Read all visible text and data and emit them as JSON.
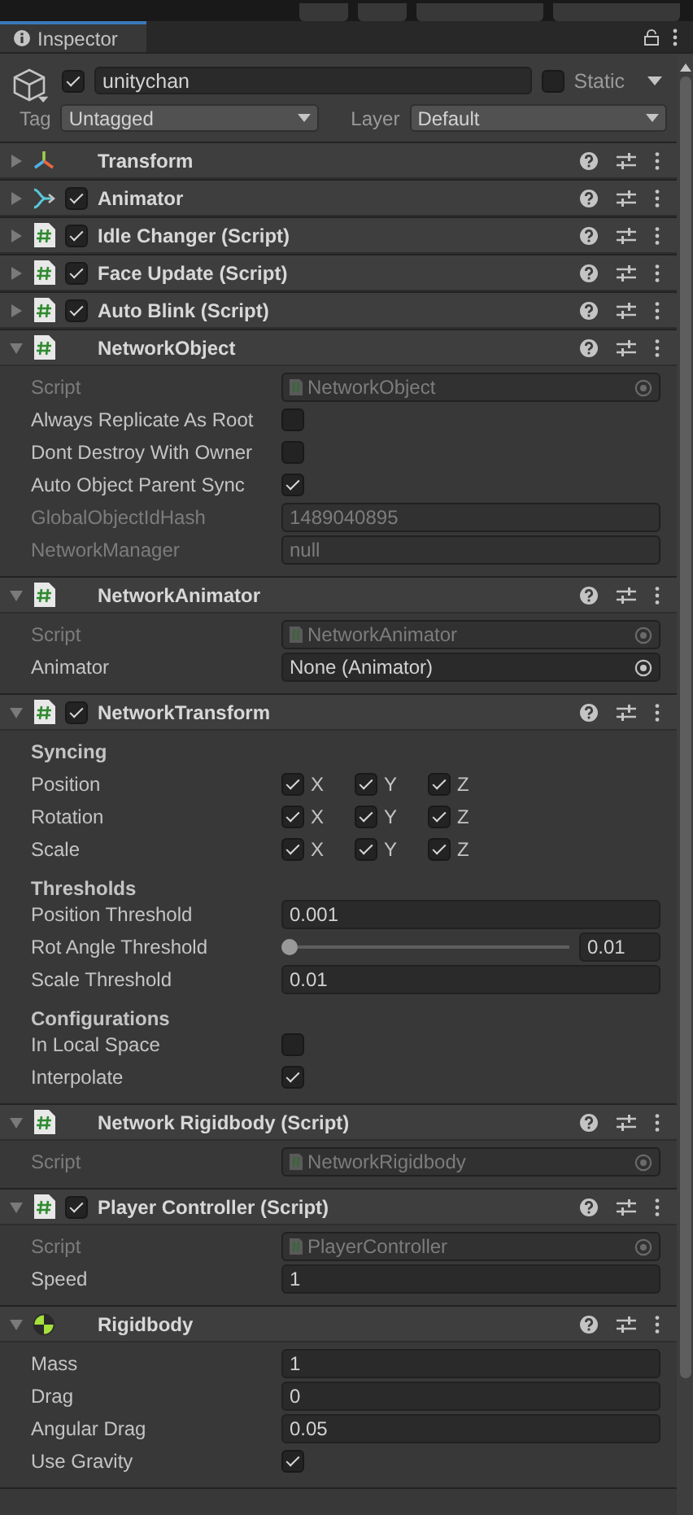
{
  "tab": {
    "title": "Inspector"
  },
  "object": {
    "active": true,
    "name": "unitychan",
    "static": false,
    "static_label": "Static",
    "tag_label": "Tag",
    "tag": "Untagged",
    "layer_label": "Layer",
    "layer": "Default"
  },
  "components": [
    {
      "kind": "transform",
      "title": "Transform",
      "expanded": false
    },
    {
      "kind": "animator",
      "title": "Animator",
      "expanded": false,
      "enabled": true
    },
    {
      "kind": "script",
      "title": "Idle Changer (Script)",
      "expanded": false,
      "enabled": true
    },
    {
      "kind": "script",
      "title": "Face Update (Script)",
      "expanded": false,
      "enabled": true
    },
    {
      "kind": "script",
      "title": "Auto Blink (Script)",
      "expanded": false,
      "enabled": true
    },
    {
      "kind": "script",
      "title": "NetworkObject",
      "expanded": true,
      "rows": [
        {
          "kind": "object",
          "label": "Script",
          "value": "NetworkObject",
          "disabled": true
        },
        {
          "kind": "checkbox",
          "label": "Always Replicate As Root",
          "checked": false,
          "disabled": false
        },
        {
          "kind": "checkbox",
          "label": "Dont Destroy With Owner",
          "checked": false,
          "disabled": false
        },
        {
          "kind": "checkbox",
          "label": "Auto Object Parent Sync",
          "checked": true,
          "disabled": false
        },
        {
          "kind": "text",
          "label": "GlobalObjectIdHash",
          "value": "1489040895",
          "disabled": true
        },
        {
          "kind": "text",
          "label": "NetworkManager",
          "value": "null",
          "disabled": true
        }
      ]
    },
    {
      "kind": "script",
      "title": "NetworkAnimator",
      "expanded": true,
      "rows": [
        {
          "kind": "object",
          "label": "Script",
          "value": "NetworkAnimator",
          "disabled": true
        },
        {
          "kind": "object",
          "label": "Animator",
          "value": "None (Animator)",
          "disabled": false
        }
      ]
    },
    {
      "kind": "script",
      "title": "NetworkTransform",
      "expanded": true,
      "enabled": true,
      "rows": [
        {
          "kind": "heading",
          "label": "Syncing"
        },
        {
          "kind": "xyz",
          "label": "Position",
          "disabled": false,
          "axes": [
            {
              "label": "X",
              "checked": true
            },
            {
              "label": "Y",
              "checked": true
            },
            {
              "label": "Z",
              "checked": true
            }
          ]
        },
        {
          "kind": "xyz",
          "label": "Rotation",
          "disabled": false,
          "axes": [
            {
              "label": "X",
              "checked": true
            },
            {
              "label": "Y",
              "checked": true
            },
            {
              "label": "Z",
              "checked": true
            }
          ]
        },
        {
          "kind": "xyz",
          "label": "Scale",
          "disabled": false,
          "axes": [
            {
              "label": "X",
              "checked": true
            },
            {
              "label": "Y",
              "checked": true
            },
            {
              "label": "Z",
              "checked": true
            }
          ]
        },
        {
          "kind": "heading",
          "label": "Thresholds"
        },
        {
          "kind": "text",
          "label": "Position Threshold",
          "value": "0.001",
          "disabled": false
        },
        {
          "kind": "slider",
          "label": "Rot Angle Threshold",
          "level": 0,
          "value": "0.01",
          "disabled": false
        },
        {
          "kind": "text",
          "label": "Scale Threshold",
          "value": "0.01",
          "disabled": false
        },
        {
          "kind": "heading",
          "label": "Configurations"
        },
        {
          "kind": "checkbox",
          "label": "In Local Space",
          "checked": false,
          "disabled": false
        },
        {
          "kind": "checkbox",
          "label": "Interpolate",
          "checked": true,
          "disabled": false
        }
      ]
    },
    {
      "kind": "script",
      "title": "Network Rigidbody (Script)",
      "expanded": true,
      "rows": [
        {
          "kind": "object",
          "label": "Script",
          "value": "NetworkRigidbody",
          "disabled": true
        }
      ]
    },
    {
      "kind": "script",
      "title": "Player Controller (Script)",
      "expanded": true,
      "enabled": true,
      "rows": [
        {
          "kind": "object",
          "label": "Script",
          "value": "PlayerController",
          "disabled": true
        },
        {
          "kind": "text",
          "label": "Speed",
          "value": "1",
          "disabled": false
        }
      ]
    },
    {
      "kind": "rigidbody",
      "title": "Rigidbody",
      "expanded": true,
      "rows": [
        {
          "kind": "text",
          "label": "Mass",
          "value": "1",
          "disabled": false
        },
        {
          "kind": "text",
          "label": "Drag",
          "value": "0",
          "disabled": false
        },
        {
          "kind": "text",
          "label": "Angular Drag",
          "value": "0.05",
          "disabled": false
        },
        {
          "kind": "checkbox",
          "label": "Use Gravity",
          "checked": true,
          "disabled": false
        }
      ]
    }
  ]
}
